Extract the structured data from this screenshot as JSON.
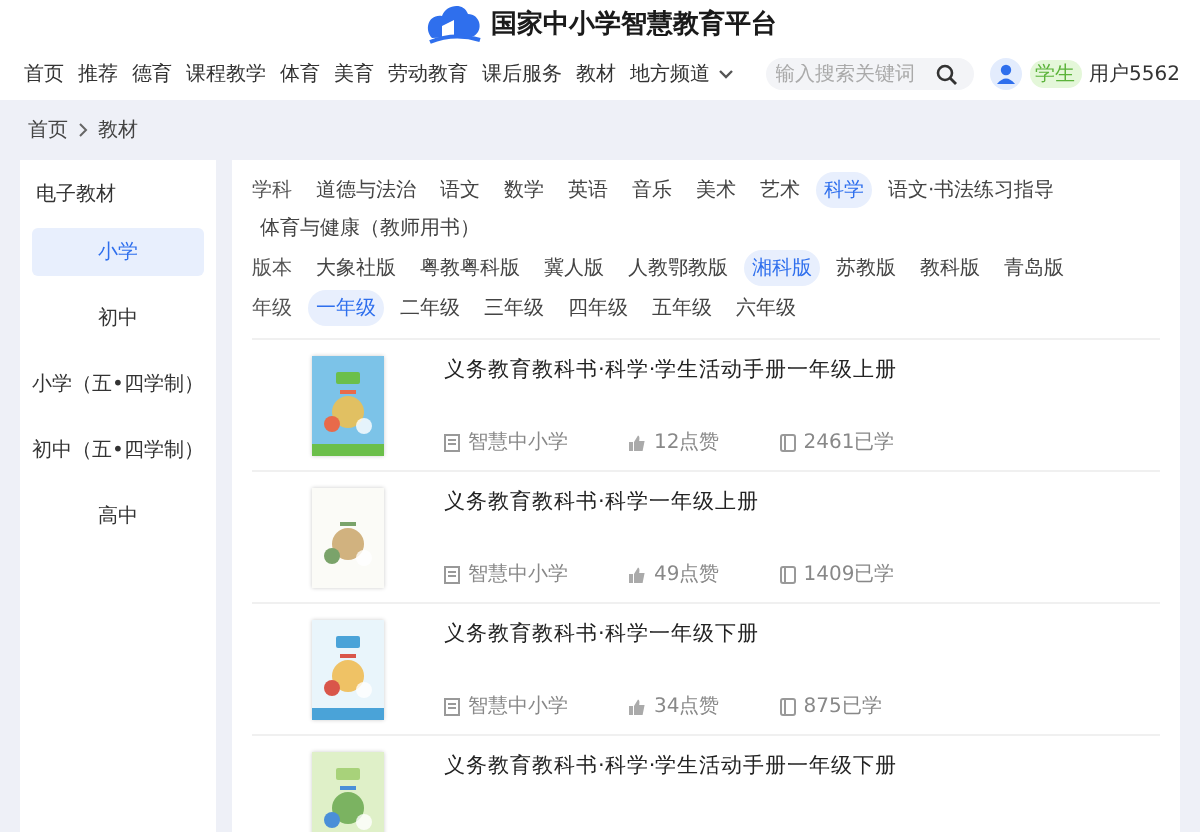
{
  "site_title": "国家中小学智慧教育平台",
  "nav": [
    {
      "label": "首页",
      "selected": false
    },
    {
      "label": "推荐",
      "selected": false
    },
    {
      "label": "德育",
      "selected": false
    },
    {
      "label": "课程教学",
      "selected": false
    },
    {
      "label": "体育",
      "selected": false
    },
    {
      "label": "美育",
      "selected": false
    },
    {
      "label": "劳动教育",
      "selected": false
    },
    {
      "label": "课后服务",
      "selected": false
    },
    {
      "label": "教材",
      "selected": false
    },
    {
      "label": "地方频道",
      "selected": false,
      "kind": "dropdown"
    }
  ],
  "search": {
    "placeholder": "输入搜索关键词"
  },
  "user": {
    "badge": "学生",
    "name": "用户5562"
  },
  "breadcrumb": [
    "首页",
    "教材"
  ],
  "sidebar": {
    "title": "电子教材",
    "items": [
      {
        "label": "小学",
        "selected": true
      },
      {
        "label": "初中",
        "selected": false
      },
      {
        "label": "小学（五•四学制）",
        "selected": false
      },
      {
        "label": "初中（五•四学制）",
        "selected": false
      },
      {
        "label": "高中",
        "selected": false
      }
    ]
  },
  "filters": [
    {
      "label": "学科",
      "options": [
        {
          "label": "道德与法治",
          "selected": false
        },
        {
          "label": "语文",
          "selected": false
        },
        {
          "label": "数学",
          "selected": false
        },
        {
          "label": "英语",
          "selected": false
        },
        {
          "label": "音乐",
          "selected": false
        },
        {
          "label": "美术",
          "selected": false
        },
        {
          "label": "艺术",
          "selected": false
        },
        {
          "label": "科学",
          "selected": true
        },
        {
          "label": "语文·书法练习指导",
          "selected": false
        },
        {
          "label": "体育与健康（教师用书）",
          "selected": false
        }
      ]
    },
    {
      "label": "版本",
      "options": [
        {
          "label": "大象社版",
          "selected": false
        },
        {
          "label": "粤教粤科版",
          "selected": false
        },
        {
          "label": "冀人版",
          "selected": false
        },
        {
          "label": "人教鄂教版",
          "selected": false
        },
        {
          "label": "湘科版",
          "selected": true
        },
        {
          "label": "苏教版",
          "selected": false
        },
        {
          "label": "教科版",
          "selected": false
        },
        {
          "label": "青岛版",
          "selected": false
        }
      ]
    },
    {
      "label": "年级",
      "options": [
        {
          "label": "一年级",
          "selected": true
        },
        {
          "label": "二年级",
          "selected": false
        },
        {
          "label": "三年级",
          "selected": false
        },
        {
          "label": "四年级",
          "selected": false
        },
        {
          "label": "五年级",
          "selected": false
        },
        {
          "label": "六年级",
          "selected": false
        }
      ]
    }
  ],
  "books": [
    {
      "title": "义务教育教科书·科学·学生活动手册一年级上册",
      "kind": "picture",
      "source": "智慧中小学",
      "likes": "12点赞",
      "learners": "2461已学"
    },
    {
      "title": "义务教育教科书·科学一年级上册",
      "kind": "picture",
      "source": "智慧中小学",
      "likes": "49点赞",
      "learners": "1409已学"
    },
    {
      "title": "义务教育教科书·科学一年级下册",
      "kind": "picture",
      "source": "智慧中小学",
      "likes": "34点赞",
      "learners": "875已学"
    },
    {
      "title": "义务教育教科书·科学·学生活动手册一年级下册",
      "kind": "picture"
    }
  ]
}
